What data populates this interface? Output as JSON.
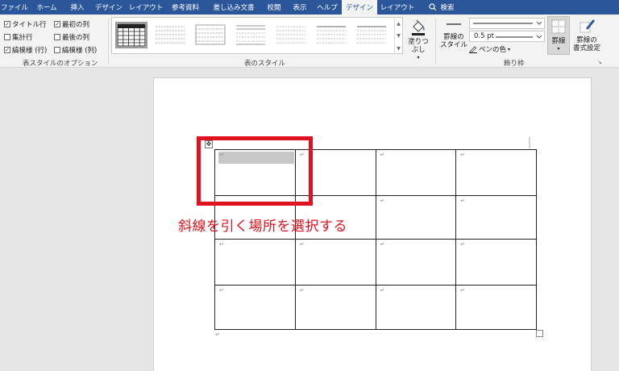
{
  "tabs": [
    "ファイル",
    "ホーム",
    "挿入",
    "デザイン",
    "レイアウト",
    "参考資料",
    "差し込み文書",
    "校閲",
    "表示",
    "ヘルプ",
    "デザイン",
    "レイアウト",
    "検索"
  ],
  "table_style_options": {
    "items": [
      {
        "label": "タイトル行",
        "checked": true
      },
      {
        "label": "最初の列",
        "checked": true
      },
      {
        "label": "集計行",
        "checked": false
      },
      {
        "label": "最後の列",
        "checked": false
      },
      {
        "label": "縞模様 (行)",
        "checked": true
      },
      {
        "label": "縞模様 (列)",
        "checked": false
      }
    ],
    "group_label": "表スタイルのオプション"
  },
  "table_styles": {
    "group_label": "表のスタイル",
    "shading_label": "塗りつぶし"
  },
  "borders": {
    "border_styles_label": [
      "罫線の",
      "スタイル"
    ],
    "pen_weight": "0.5 pt",
    "pen_color_label": "ペンの色",
    "borders_label": "罫線",
    "border_painter_label": [
      "罫線の",
      "書式設定"
    ],
    "group_label": "飾り枠"
  },
  "document": {
    "cell_mark": "↵",
    "annotation": "斜線を引く場所を選択する",
    "annotation_color": "#e0121f",
    "ribbon_accent": "#2b579a"
  }
}
